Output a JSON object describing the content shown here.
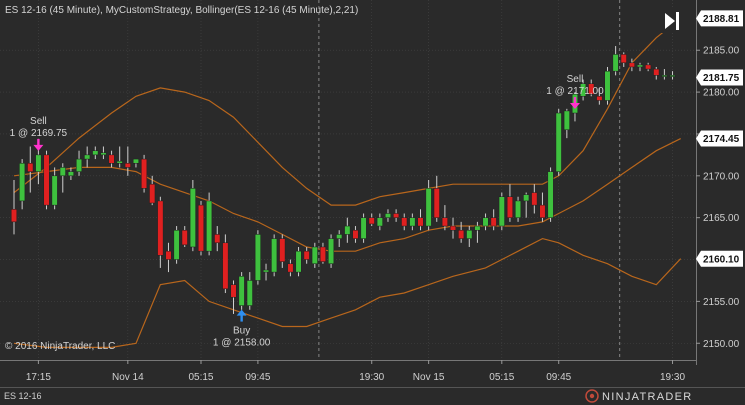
{
  "title": "ES 12-16 (45 Minute), MyCustomStrategy, Bollinger(ES 12-16 (45 Minute),2,21)",
  "copyright": "© 2016 NinjaTrader, LLC",
  "instrument_tab": "ES 12-16",
  "brand": "NINJATRADER",
  "colors": {
    "background": "#2a2a2a",
    "grid": "#5a5a5a",
    "up_candle": "#3ec13e",
    "down_candle": "#e02020",
    "bollinger": "#b8661c",
    "signal_arrow_sell": "#ff33cc",
    "signal_arrow_buy": "#2e8ff0",
    "badge": "#ffffff"
  },
  "chart_data": {
    "type": "candlestick",
    "title": "ES 12-16 (45 Minute), MyCustomStrategy, Bollinger(ES 12-16 (45 Minute),2,21)",
    "ylim": [
      2148,
      2191
    ],
    "y_ticks": [
      2150.0,
      2155.0,
      2160.0,
      2165.0,
      2170.0,
      2175.0,
      2180.0,
      2185.0
    ],
    "x_ticks": [
      {
        "bar": 3,
        "label": "17:15"
      },
      {
        "bar": 14,
        "label": "Nov 14"
      },
      {
        "bar": 23,
        "label": "05:15"
      },
      {
        "bar": 30,
        "label": "09:45"
      },
      {
        "bar": 44,
        "label": "19:30"
      },
      {
        "bar": 51,
        "label": "Nov 15"
      },
      {
        "bar": 60,
        "label": "05:15"
      },
      {
        "bar": 67,
        "label": "09:45"
      },
      {
        "bar": 81,
        "label": "19:30"
      }
    ],
    "session_breaks": [
      37,
      74
    ],
    "value_badges": [
      2188.81,
      2181.75,
      2174.45,
      2160.1
    ],
    "bars": [
      [
        2166,
        2169.5,
        2163,
        2164.5
      ],
      [
        2167,
        2172,
        2166,
        2171.5
      ],
      [
        2171.5,
        2173.5,
        2168,
        2170.5
      ],
      [
        2170.5,
        2174,
        2169,
        2172.5
      ],
      [
        2172.5,
        2173,
        2166,
        2166.5
      ],
      [
        2166.5,
        2171,
        2166,
        2170
      ],
      [
        2170,
        2171.5,
        2168,
        2171
      ],
      [
        2170,
        2171,
        2169.5,
        2170.5
      ],
      [
        2170.5,
        2173,
        2170,
        2172
      ],
      [
        2172,
        2173.5,
        2171,
        2172.5
      ],
      [
        2172.5,
        2173.5,
        2172,
        2173
      ],
      [
        2172.5,
        2173.5,
        2172,
        2172.75
      ],
      [
        2172.5,
        2173,
        2171,
        2171.5
      ],
      [
        2171.5,
        2173.5,
        2171,
        2171.75
      ],
      [
        2171.5,
        2173.5,
        2170,
        2171
      ],
      [
        2171.5,
        2172,
        2171,
        2172
      ],
      [
        2172,
        2172.5,
        2168,
        2168.5
      ],
      [
        2169,
        2170,
        2166.5,
        2166.75
      ],
      [
        2167,
        2167.5,
        2159,
        2160.5
      ],
      [
        2161,
        2162,
        2158.5,
        2160
      ],
      [
        2160,
        2164,
        2159.5,
        2163.5
      ],
      [
        2163.5,
        2164,
        2161.5,
        2161.75
      ],
      [
        2161.5,
        2169.5,
        2161,
        2168.5
      ],
      [
        2166.5,
        2167,
        2160.5,
        2161
      ],
      [
        2161,
        2168,
        2160.5,
        2167
      ],
      [
        2163,
        2164,
        2161,
        2162
      ],
      [
        2162,
        2163,
        2156,
        2156.5
      ],
      [
        2157,
        2157.5,
        2153.5,
        2155.5
      ],
      [
        2154.5,
        2158.5,
        2154,
        2158
      ],
      [
        2154.5,
        2158.5,
        2154,
        2157.5
      ],
      [
        2157.5,
        2163.5,
        2157,
        2163
      ],
      [
        2158.5,
        2159.5,
        2157.5,
        2158.75
      ],
      [
        2158.5,
        2163,
        2158,
        2162.5
      ],
      [
        2162.5,
        2163,
        2159,
        2159.75
      ],
      [
        2159.5,
        2160,
        2158,
        2158.5
      ],
      [
        2158.5,
        2161.5,
        2158,
        2161
      ],
      [
        2161,
        2161.5,
        2159.5,
        2160
      ],
      [
        2159.5,
        2162,
        2159,
        2161.5
      ],
      [
        2161.5,
        2162,
        2159.5,
        2159.75
      ],
      [
        2159.5,
        2163,
        2159,
        2162.5
      ],
      [
        2162.5,
        2163.5,
        2161.5,
        2163
      ],
      [
        2163,
        2165,
        2162,
        2164
      ],
      [
        2163.5,
        2164,
        2162,
        2162.5
      ],
      [
        2162.5,
        2165.5,
        2162,
        2165
      ],
      [
        2165,
        2165.5,
        2164,
        2164.25
      ],
      [
        2164,
        2165.5,
        2163.5,
        2165
      ],
      [
        2165,
        2166,
        2164.5,
        2165.5
      ],
      [
        2165.5,
        2166,
        2164.5,
        2165
      ],
      [
        2165,
        2165.5,
        2163.5,
        2164
      ],
      [
        2164,
        2165.5,
        2163.5,
        2165
      ],
      [
        2165,
        2166,
        2163.5,
        2164
      ],
      [
        2164,
        2169.5,
        2163.5,
        2168.5
      ],
      [
        2168.5,
        2170,
        2164.5,
        2165
      ],
      [
        2165,
        2166.5,
        2163.5,
        2164
      ],
      [
        2164,
        2165,
        2162.5,
        2163.5
      ],
      [
        2163.5,
        2164.5,
        2162,
        2162.5
      ],
      [
        2162.5,
        2164,
        2161.5,
        2163.5
      ],
      [
        2163.5,
        2164.5,
        2162,
        2164
      ],
      [
        2164,
        2165.5,
        2163.5,
        2165
      ],
      [
        2165,
        2166,
        2163.5,
        2164
      ],
      [
        2164,
        2168,
        2163.5,
        2167.5
      ],
      [
        2167.5,
        2169,
        2164.5,
        2165
      ],
      [
        2165,
        2167.5,
        2164.5,
        2167
      ],
      [
        2167,
        2168,
        2165,
        2167.75
      ],
      [
        2168,
        2169,
        2165.5,
        2166.5
      ],
      [
        2166.5,
        2168,
        2164.5,
        2165
      ],
      [
        2165,
        2171,
        2164.5,
        2170.5
      ],
      [
        2170.5,
        2178,
        2170,
        2177.5
      ],
      [
        2175.5,
        2178,
        2174.5,
        2177.75
      ],
      [
        2177.5,
        2180,
        2176.5,
        2179.75
      ],
      [
        2179.5,
        2181.5,
        2179,
        2181
      ],
      [
        2181,
        2181.5,
        2179.5,
        2179.75
      ],
      [
        2179.5,
        2180.5,
        2178.5,
        2179
      ],
      [
        2179,
        2183,
        2178.5,
        2182.5
      ],
      [
        2182.5,
        2185.5,
        2182,
        2184.5
      ],
      [
        2184.5,
        2184.75,
        2183,
        2183.5
      ],
      [
        2183.5,
        2184,
        2182.5,
        2183
      ],
      [
        2183,
        2183.5,
        2182.5,
        2183.25
      ],
      [
        2183.25,
        2183.5,
        2182.5,
        2182.75
      ],
      [
        2182.75,
        2183,
        2181.5,
        2182
      ],
      [
        2182,
        2182.75,
        2181.5,
        2182
      ],
      [
        2182,
        2182.5,
        2181.5,
        2182
      ]
    ],
    "bollinger_upper": [
      [
        0,
        2168
      ],
      [
        4,
        2171
      ],
      [
        8,
        2174.5
      ],
      [
        12,
        2177.5
      ],
      [
        15,
        2179.5
      ],
      [
        18,
        2180.5
      ],
      [
        21,
        2180
      ],
      [
        24,
        2179
      ],
      [
        27,
        2177
      ],
      [
        30,
        2174
      ],
      [
        33,
        2171
      ],
      [
        36,
        2168.5
      ],
      [
        39,
        2166.5
      ],
      [
        42,
        2166.5
      ],
      [
        45,
        2167.5
      ],
      [
        48,
        2168
      ],
      [
        51,
        2168.5
      ],
      [
        54,
        2169
      ],
      [
        58,
        2169
      ],
      [
        62,
        2169
      ],
      [
        65,
        2169
      ],
      [
        67,
        2170
      ],
      [
        70,
        2173
      ],
      [
        73,
        2178
      ],
      [
        76,
        2183.5
      ],
      [
        79,
        2186.5
      ],
      [
        82,
        2188.81
      ]
    ],
    "bollinger_middle": [
      [
        0,
        2170
      ],
      [
        4,
        2170.5
      ],
      [
        8,
        2171
      ],
      [
        12,
        2171
      ],
      [
        15,
        2170.5
      ],
      [
        18,
        2169
      ],
      [
        21,
        2168
      ],
      [
        24,
        2167
      ],
      [
        27,
        2165.5
      ],
      [
        30,
        2164.5
      ],
      [
        33,
        2163
      ],
      [
        36,
        2161.5
      ],
      [
        39,
        2161
      ],
      [
        42,
        2161
      ],
      [
        45,
        2162
      ],
      [
        48,
        2162.5
      ],
      [
        51,
        2163.5
      ],
      [
        54,
        2164
      ],
      [
        58,
        2164
      ],
      [
        62,
        2164
      ],
      [
        65,
        2164.5
      ],
      [
        67,
        2165.5
      ],
      [
        70,
        2167
      ],
      [
        73,
        2169
      ],
      [
        76,
        2171
      ],
      [
        79,
        2173
      ],
      [
        82,
        2174.45
      ]
    ],
    "bollinger_lower": [
      [
        0,
        2150
      ],
      [
        4,
        2149.5
      ],
      [
        8,
        2149.5
      ],
      [
        12,
        2149.5
      ],
      [
        15,
        2150
      ],
      [
        18,
        2157
      ],
      [
        21,
        2157.5
      ],
      [
        24,
        2155
      ],
      [
        27,
        2154
      ],
      [
        30,
        2153
      ],
      [
        33,
        2152
      ],
      [
        36,
        2152
      ],
      [
        39,
        2153
      ],
      [
        42,
        2154
      ],
      [
        45,
        2155.5
      ],
      [
        48,
        2156
      ],
      [
        51,
        2157
      ],
      [
        54,
        2158
      ],
      [
        58,
        2159
      ],
      [
        62,
        2161
      ],
      [
        65,
        2162.5
      ],
      [
        67,
        2162
      ],
      [
        70,
        2160.5
      ],
      [
        73,
        2159.5
      ],
      [
        76,
        2158
      ],
      [
        79,
        2157
      ],
      [
        82,
        2160.1
      ]
    ],
    "signals": [
      {
        "type": "sell",
        "bar": 3,
        "price": 2172.5,
        "label1": "Sell",
        "label2": "1 @ 2169.75"
      },
      {
        "type": "buy",
        "bar": 28,
        "price": 2154.5,
        "label1": "Buy",
        "label2": "1 @ 2158.00"
      },
      {
        "type": "sell",
        "bar": 69,
        "price": 2177.5,
        "label1": "Sell",
        "label2": "1 @ 2171.00"
      }
    ]
  }
}
